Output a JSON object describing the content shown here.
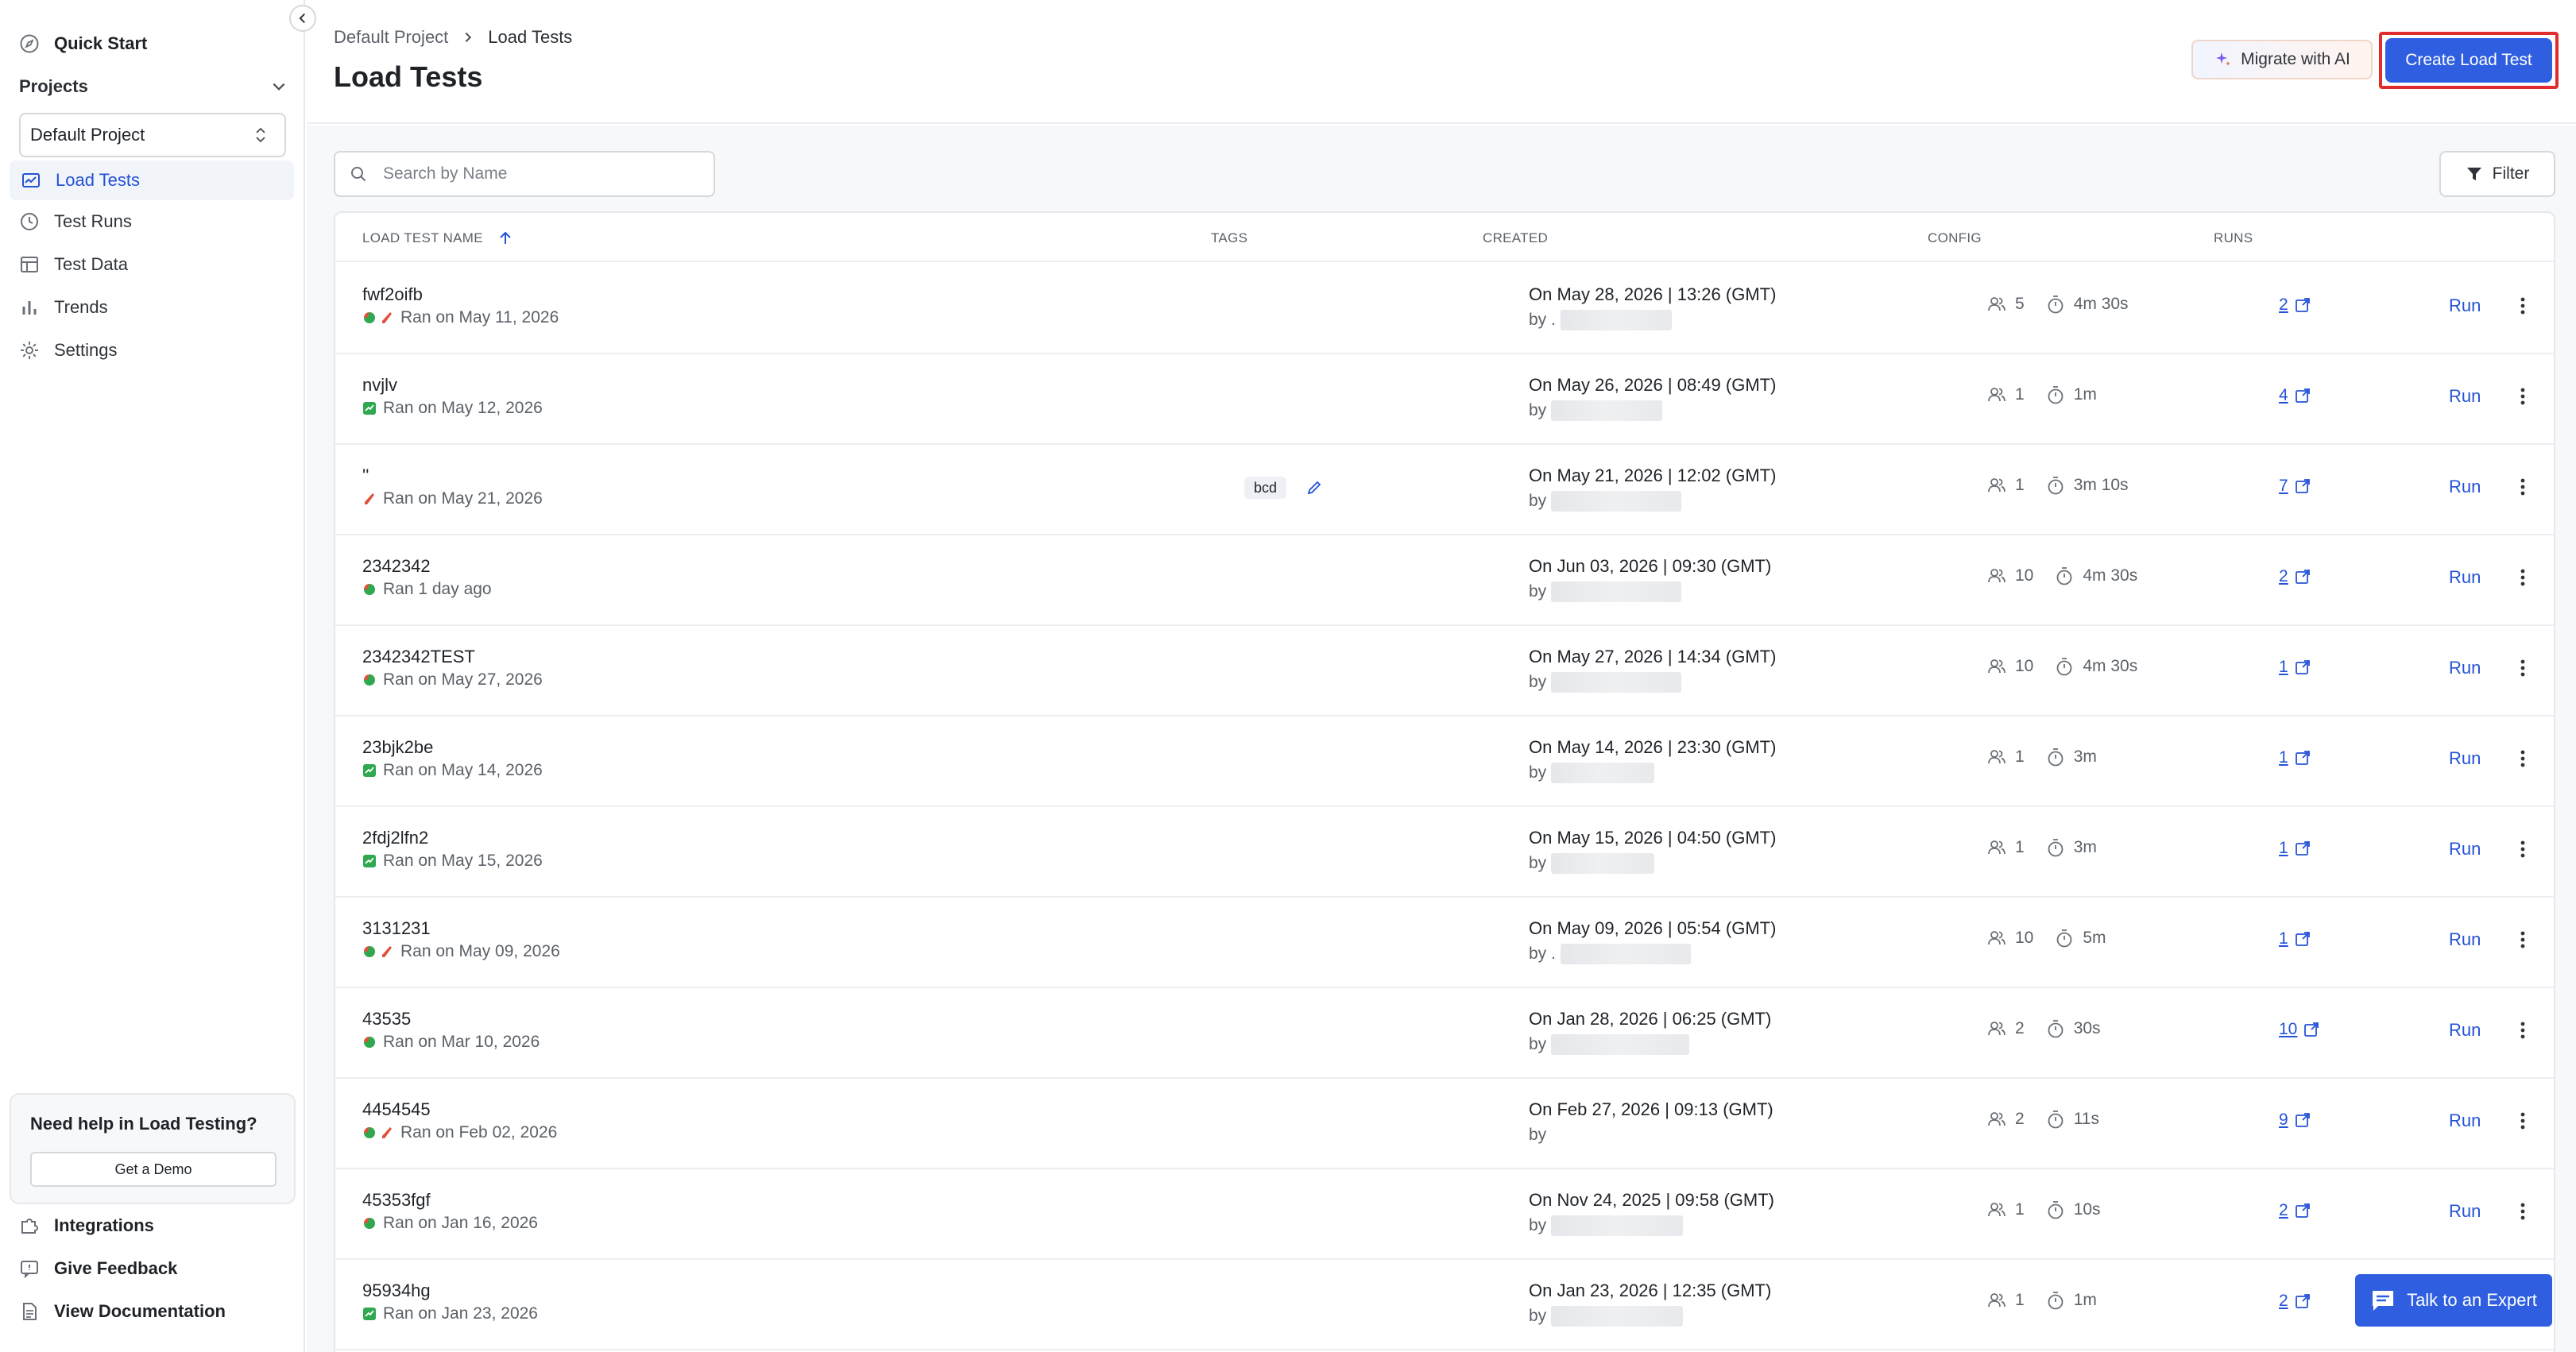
{
  "sidebar": {
    "quick_start": "Quick Start",
    "projects_label": "Projects",
    "project_selected": "Default Project",
    "nav": [
      "Load Tests",
      "Test Runs",
      "Test Data",
      "Trends",
      "Settings"
    ],
    "help_title": "Need help in Load Testing?",
    "demo_label": "Get a Demo",
    "bottom": [
      "Integrations",
      "Give Feedback",
      "View Documentation"
    ]
  },
  "header": {
    "breadcrumb_root": "Default Project",
    "breadcrumb_current": "Load Tests",
    "title": "Load Tests",
    "migrate_label": "Migrate with AI",
    "create_label": "Create Load Test"
  },
  "toolbar": {
    "search_placeholder": "Search by Name",
    "filter_label": "Filter"
  },
  "table": {
    "columns": [
      "LOAD TEST NAME",
      "TAGS",
      "CREATED",
      "CONFIG",
      "RUNS"
    ],
    "run_label": "Run",
    "rows": [
      {
        "name": "fwf2oifb",
        "status": "Ran on May 11, 2026",
        "icons": [
          "mixed",
          "fail"
        ],
        "tag": "",
        "created": "On May 28, 2026 | 13:26 (GMT)",
        "by": "by .",
        "users": "5",
        "duration": "4m 30s",
        "runs": "2"
      },
      {
        "name": "nvjlv",
        "status": "Ran on May 12, 2026",
        "icons": [
          "pass"
        ],
        "tag": "",
        "created": "On May 26, 2026 | 08:49 (GMT)",
        "by": "by",
        "users": "1",
        "duration": "1m",
        "runs": "4"
      },
      {
        "name": "''",
        "status": "Ran on May 21, 2026",
        "icons": [
          "fail"
        ],
        "tag": "bcd",
        "created": "On May 21, 2026 | 12:02 (GMT)",
        "by": "by",
        "users": "1",
        "duration": "3m 10s",
        "runs": "7"
      },
      {
        "name": "2342342",
        "status": "Ran 1 day ago",
        "icons": [
          "mixed"
        ],
        "tag": "",
        "created": "On Jun 03, 2026 | 09:30 (GMT)",
        "by": "by",
        "users": "10",
        "duration": "4m 30s",
        "runs": "2"
      },
      {
        "name": "2342342TEST",
        "status": "Ran on May 27, 2026",
        "icons": [
          "mixed"
        ],
        "tag": "",
        "created": "On May 27, 2026 | 14:34 (GMT)",
        "by": "by",
        "users": "10",
        "duration": "4m 30s",
        "runs": "1"
      },
      {
        "name": "23bjk2be",
        "status": "Ran on May 14, 2026",
        "icons": [
          "pass"
        ],
        "tag": "",
        "created": "On May 14, 2026 | 23:30 (GMT)",
        "by": "by",
        "users": "1",
        "duration": "3m",
        "runs": "1"
      },
      {
        "name": "2fdj2lfn2",
        "status": "Ran on May 15, 2026",
        "icons": [
          "pass"
        ],
        "tag": "",
        "created": "On May 15, 2026 | 04:50 (GMT)",
        "by": "by",
        "users": "1",
        "duration": "3m",
        "runs": "1"
      },
      {
        "name": "3131231",
        "status": "Ran on May 09, 2026",
        "icons": [
          "mixed",
          "fail"
        ],
        "tag": "",
        "created": "On May 09, 2026 | 05:54 (GMT)",
        "by": "by .",
        "users": "10",
        "duration": "5m",
        "runs": "1"
      },
      {
        "name": "43535",
        "status": "Ran on Mar 10, 2026",
        "icons": [
          "mixed"
        ],
        "tag": "",
        "created": "On Jan 28, 2026 | 06:25 (GMT)",
        "by": "by",
        "users": "2",
        "duration": "30s",
        "runs": "10"
      },
      {
        "name": "4454545",
        "status": "Ran on Feb 02, 2026",
        "icons": [
          "mixed",
          "fail"
        ],
        "tag": "",
        "created": "On Feb 27, 2026 | 09:13 (GMT)",
        "by": "by",
        "users": "2",
        "duration": "11s",
        "runs": "9"
      },
      {
        "name": "45353fgf",
        "status": "Ran on Jan 16, 2026",
        "icons": [
          "mixed"
        ],
        "tag": "",
        "created": "On Nov 24, 2025 | 09:58 (GMT)",
        "by": "by",
        "users": "1",
        "duration": "10s",
        "runs": "2"
      },
      {
        "name": "95934hg",
        "status": "Ran on Jan 23, 2026",
        "icons": [
          "pass"
        ],
        "tag": "",
        "created": "On Jan 23, 2026 | 12:35 (GMT)",
        "by": "by",
        "users": "1",
        "duration": "1m",
        "runs": "2"
      }
    ]
  },
  "expert_label": "Talk to an Expert",
  "colors": {
    "accent": "#2f5fe0",
    "link": "#2452d6",
    "highlight": "#e02c2c",
    "pass": "#2fa84f",
    "fail": "#e0503a"
  }
}
